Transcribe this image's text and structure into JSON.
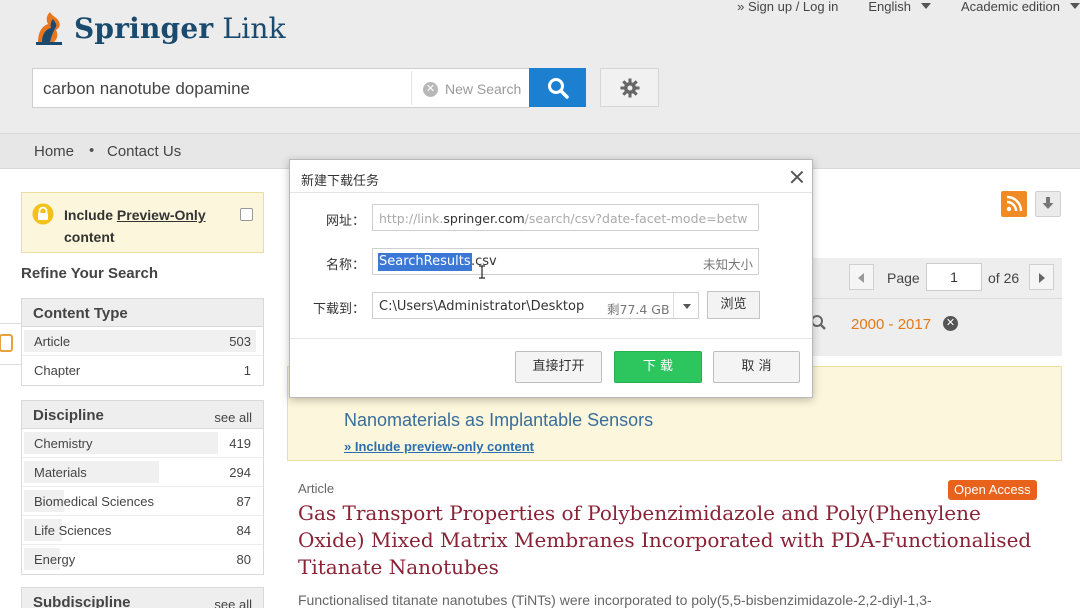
{
  "header": {
    "logo_primary": "Springer",
    "logo_secondary": "Link",
    "sign_in": "» Sign up / Log in",
    "language": "English",
    "edition": "Academic edition",
    "search_value": "carbon nanotube dopamine",
    "new_search": "New Search"
  },
  "nav": {
    "home": "Home",
    "separator": "•",
    "contact": "Contact Us"
  },
  "sidebar": {
    "preview_label_a": "Include ",
    "preview_label_b": "Preview-Only",
    "preview_label_c": "content",
    "refine": "Refine Your Search",
    "content_type": {
      "title": "Content Type",
      "items": [
        {
          "label": "Article",
          "count": "503",
          "share": 0.98
        },
        {
          "label": "Chapter",
          "count": "1",
          "share": 0.0
        }
      ]
    },
    "discipline": {
      "title": "Discipline",
      "see_all": "see all",
      "items": [
        {
          "label": "Chemistry",
          "count": "419",
          "share": 0.82
        },
        {
          "label": "Materials",
          "count": "294",
          "share": 0.57
        },
        {
          "label": "Biomedical Sciences",
          "count": "87",
          "share": 0.17
        },
        {
          "label": "Life Sciences",
          "count": "84",
          "share": 0.16
        },
        {
          "label": "Energy",
          "count": "80",
          "share": 0.15
        }
      ]
    },
    "subdiscipline": {
      "title": "Subdiscipline",
      "see_all": "see all"
    }
  },
  "results": {
    "page_label": "Page",
    "page_value": "1",
    "page_of": "of 26",
    "date_range": "2000 - 2017",
    "notice_title": "Nanomaterials as Implantable Sensors",
    "notice_link": "» Include preview-only content",
    "item_type": "Article",
    "open_access": "Open Access",
    "item_title": "Gas Transport Properties of Polybenzimidazole and Poly(Phenylene Oxide) Mixed Matrix Membranes Incorporated with PDA-Functionalised Titanate Nanotubes",
    "item_snippet": "Functionalised titanate nanotubes (TiNTs) were incorporated to poly(5,5-bisbenzimidazole-2,2-diyl-1,3-"
  },
  "dialog": {
    "title": "新建下载任务",
    "url_label": "网址：",
    "url_prefix": "http://link.",
    "url_domain": "springer.com",
    "url_rest": "/search/csv?date-facet-mode=betw",
    "name_label": "名称：",
    "name_selected": "SearchResults",
    "name_ext": ".csv",
    "name_size": "未知大小",
    "path_label": "下载到：",
    "path_value": "C:\\Users\\Administrator\\Desktop",
    "path_free": "剩77.4 GB",
    "browse": "浏览",
    "open_direct": "直接打开",
    "download": "下 载",
    "cancel": "取 消"
  },
  "colors": {
    "brand_blue": "#1d7fcf",
    "title_red": "#8a2236",
    "open_access": "#e8621c",
    "download_green": "#2dc55e"
  }
}
